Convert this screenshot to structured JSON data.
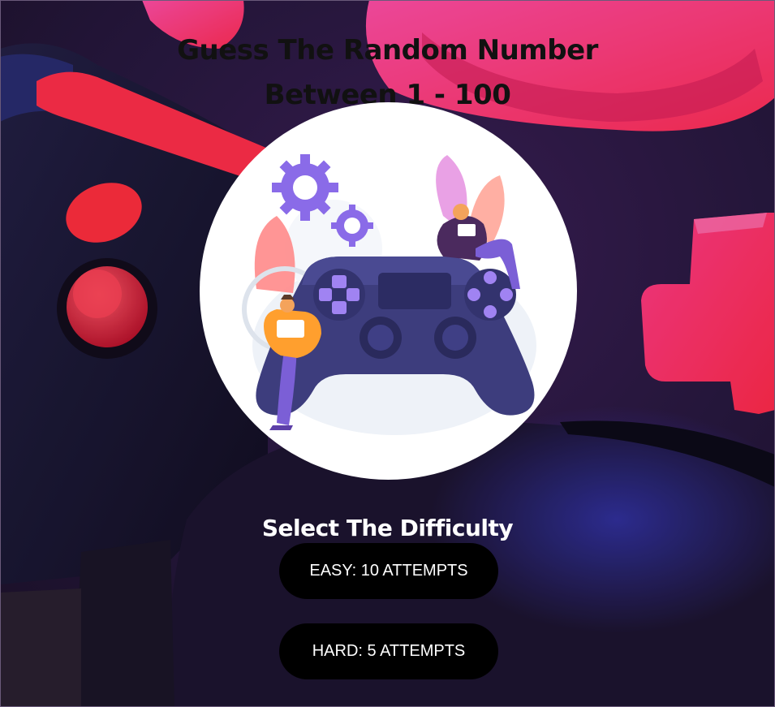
{
  "header": {
    "title_line1": "Guess The Random Number",
    "title_line2": "Between 1 - 100"
  },
  "hero": {
    "image_icon": "gamepad-illustration-icon"
  },
  "difficulty": {
    "heading": "Select The Difficulty",
    "options": [
      {
        "label": "EASY: 10 ATTEMPTS"
      },
      {
        "label": "HARD: 5 ATTEMPTS"
      }
    ]
  },
  "colors": {
    "button_bg": "#000000",
    "button_text": "#ffffff",
    "heading_text": "#ffffff",
    "title_text": "#111111",
    "accent_pink": "#ff3d8f",
    "accent_red": "#ff2d4a",
    "controller_navy": "#3a3a78"
  }
}
